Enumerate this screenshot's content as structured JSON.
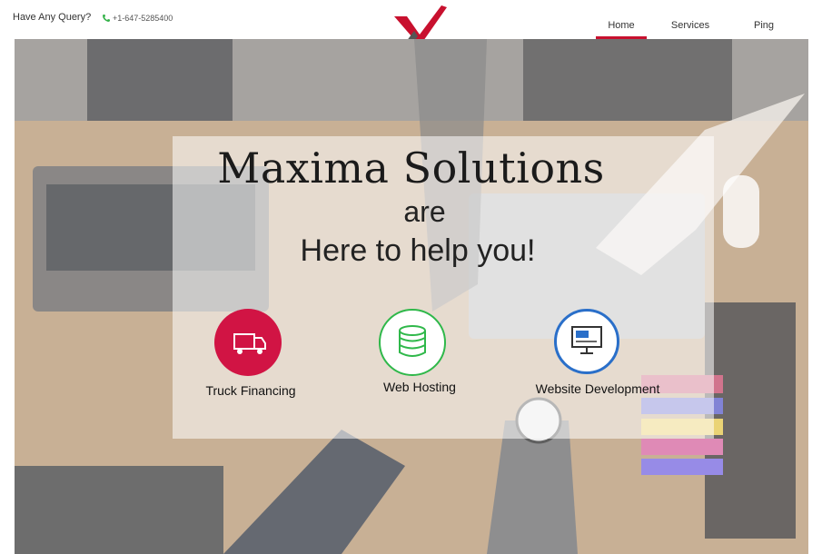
{
  "topbar": {
    "query_text": "Have Any Query?",
    "phone": "+1-647-5285400",
    "phone_icon": "phone-icon"
  },
  "logo": {
    "icon": "x-checkmark-logo",
    "colors": [
      "#c8102e",
      "#444444"
    ]
  },
  "nav": {
    "items": [
      {
        "label": "Home",
        "active": true
      },
      {
        "label": "Services",
        "active": false
      },
      {
        "label": "Ping",
        "active": false
      }
    ]
  },
  "hero": {
    "title": "Maxima Solutions",
    "line2": "are",
    "line3": "Here to help you!"
  },
  "services": [
    {
      "label": "Truck Financing",
      "icon": "truck-icon",
      "color": "#d11444"
    },
    {
      "label": "Web Hosting",
      "icon": "database-icon",
      "color": "#2fb84a"
    },
    {
      "label": "Website Development",
      "icon": "monitor-icon",
      "color": "#2a6fc9"
    }
  ],
  "colors": {
    "accent": "#c8102e"
  }
}
